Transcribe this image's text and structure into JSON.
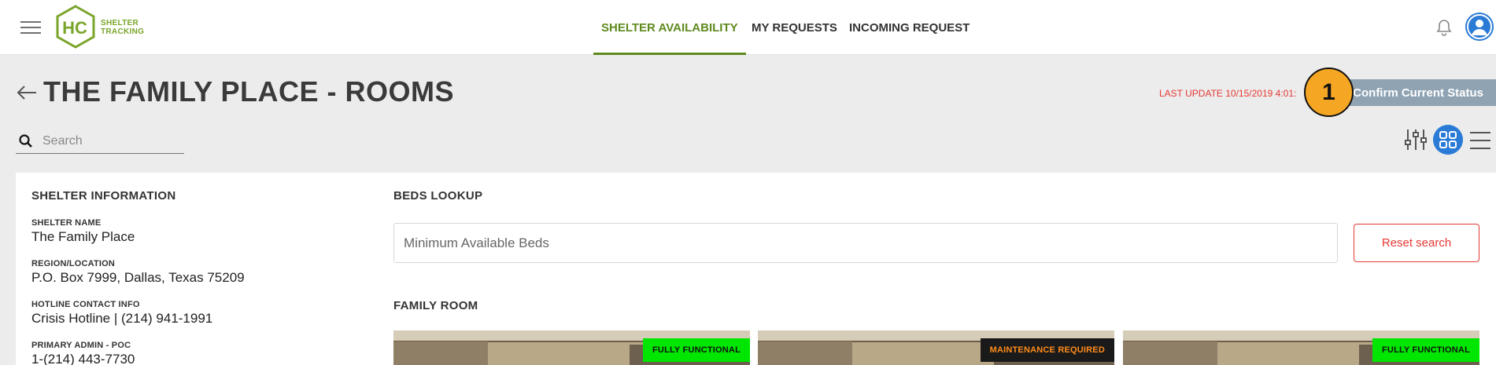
{
  "app": {
    "logo_letters": "HC",
    "logo_text_line1": "SHELTER",
    "logo_text_line2": "TRACKING"
  },
  "nav": {
    "items": [
      {
        "label": "SHELTER AVAILABILITY",
        "active": true
      },
      {
        "label": "MY REQUESTS",
        "active": false
      },
      {
        "label": "INCOMING REQUEST",
        "active": false
      }
    ]
  },
  "header": {
    "title": "THE FAMILY PLACE - ROOMS",
    "last_update": "LAST UPDATE 10/15/2019 4:01:",
    "confirm_button": "Confirm Current Status",
    "step_badge": "1"
  },
  "search": {
    "placeholder": "Search"
  },
  "shelter_info": {
    "title": "SHELTER INFORMATION",
    "fields": [
      {
        "label": "SHELTER NAME",
        "value": "The Family Place"
      },
      {
        "label": "REGION/LOCATION",
        "value": "P.O. Box 7999, Dallas, Texas 75209"
      },
      {
        "label": "HOTLINE CONTACT INFO",
        "value": "Crisis Hotline | (214) 941-1991"
      },
      {
        "label": "PRIMARY ADMIN - POC",
        "value": "1-(214) 443-7730"
      }
    ]
  },
  "beds_lookup": {
    "title": "BEDS LOOKUP",
    "placeholder": "Minimum Available Beds",
    "reset_button": "Reset search"
  },
  "rooms": {
    "section_title": "FAMILY ROOM",
    "cards": [
      {
        "status": "FULLY FUNCTIONAL",
        "status_color": "#00e600"
      },
      {
        "status": "MAINTENANCE REQUIRED",
        "status_color": "#ff8c1a"
      },
      {
        "status": "FULLY FUNCTIONAL",
        "status_color": "#00e600"
      }
    ]
  },
  "colors": {
    "brand_green": "#5f8a1e",
    "accent_blue": "#2b7bd6",
    "alert_red": "#e53935",
    "badge_orange": "#f5a623"
  }
}
